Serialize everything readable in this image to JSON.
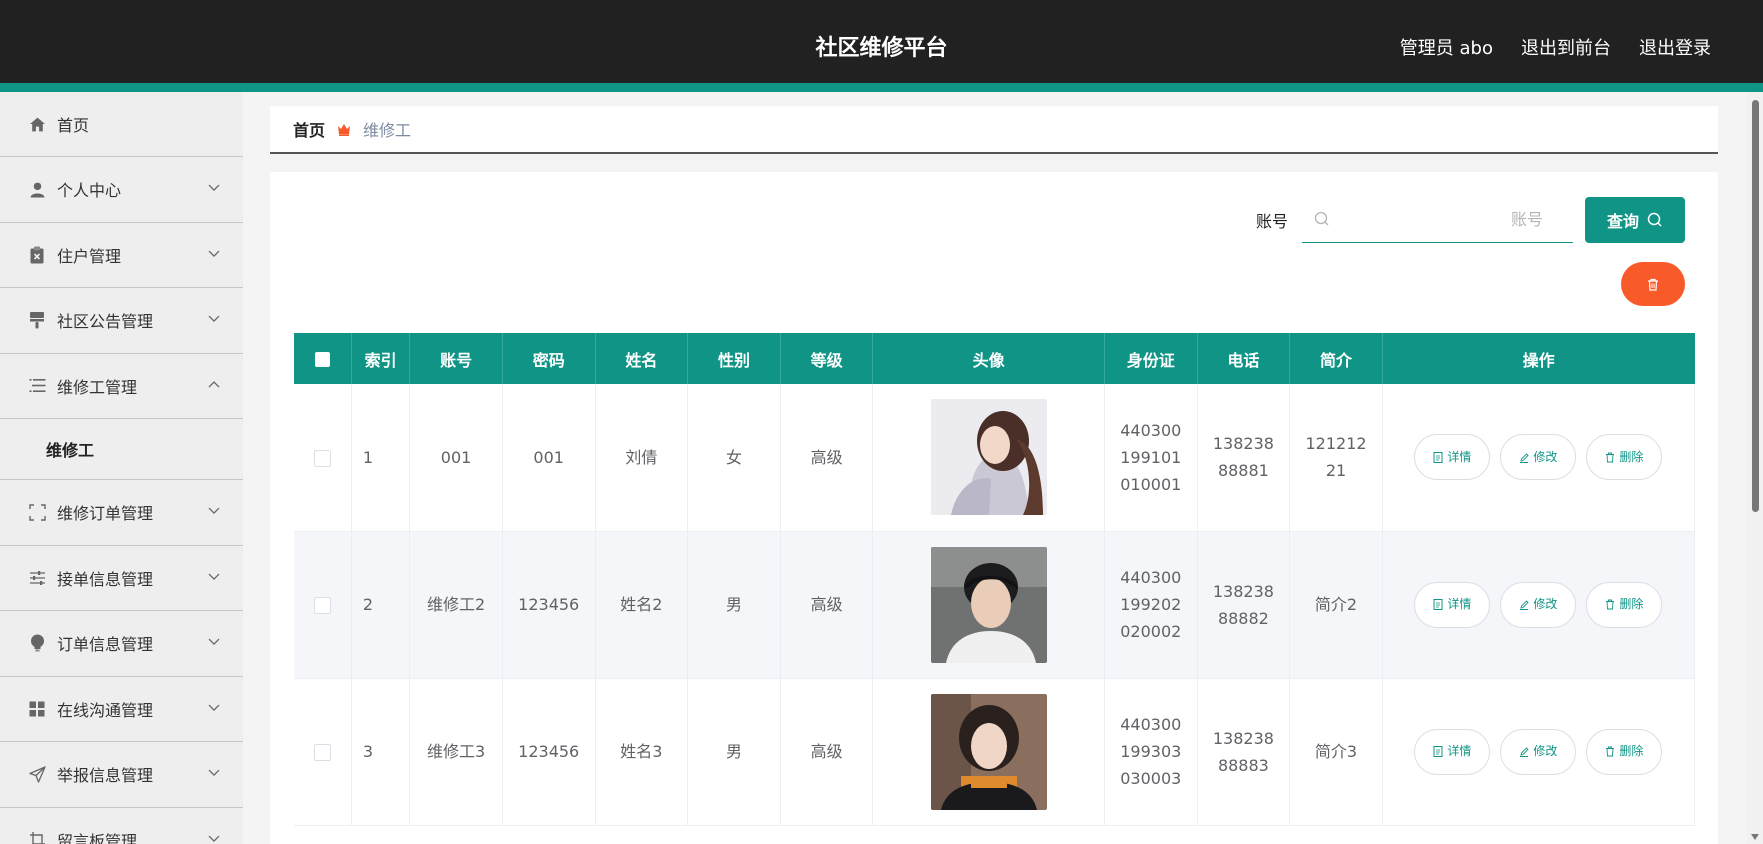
{
  "header": {
    "title": "社区维修平台",
    "admin": "管理员 abo",
    "to_front": "退出到前台",
    "logout": "退出登录"
  },
  "sidebar": {
    "items": [
      {
        "label": "首页",
        "icon": "home-icon"
      },
      {
        "label": "个人中心",
        "icon": "user-icon"
      },
      {
        "label": "住户管理",
        "icon": "clipboard-x-icon"
      },
      {
        "label": "社区公告管理",
        "icon": "paint-roller-icon"
      },
      {
        "label": "维修工管理",
        "icon": "list-icon",
        "expanded": true,
        "children": [
          "维修工"
        ]
      },
      {
        "label": "维修订单管理",
        "icon": "expand-frame-icon"
      },
      {
        "label": "接单信息管理",
        "icon": "sliders-icon"
      },
      {
        "label": "订单信息管理",
        "icon": "bulb-icon"
      },
      {
        "label": "在线沟通管理",
        "icon": "grid-icon"
      },
      {
        "label": "举报信息管理",
        "icon": "send-icon"
      },
      {
        "label": "留言板管理",
        "icon": "crop-icon"
      }
    ]
  },
  "breadcrumb": {
    "home": "首页",
    "current": "维修工"
  },
  "search": {
    "label": "账号",
    "placeholder": "账号",
    "button": "查询"
  },
  "colors": {
    "accent": "#0f9486",
    "danger": "#f95a2a",
    "header_bg": "#212121"
  },
  "table": {
    "columns": [
      "索引",
      "账号",
      "密码",
      "姓名",
      "性别",
      "等级",
      "头像",
      "身份证",
      "电话",
      "简介",
      "操作"
    ],
    "actions": {
      "detail": "详情",
      "edit": "修改",
      "delete": "删除"
    },
    "rows": [
      {
        "index": "1",
        "account": "001",
        "password": "001",
        "name": "刘倩",
        "gender": "女",
        "level": "高级",
        "id_card": "440300199101010001",
        "phone": "13823888881",
        "intro": "12121221"
      },
      {
        "index": "2",
        "account": "维修工2",
        "password": "123456",
        "name": "姓名2",
        "gender": "男",
        "level": "高级",
        "id_card": "440300199202020002",
        "phone": "13823888882",
        "intro": "简介2"
      },
      {
        "index": "3",
        "account": "维修工3",
        "password": "123456",
        "name": "姓名3",
        "gender": "男",
        "level": "高级",
        "id_card": "440300199303030003",
        "phone": "13823888883",
        "intro": "简介3"
      }
    ]
  }
}
